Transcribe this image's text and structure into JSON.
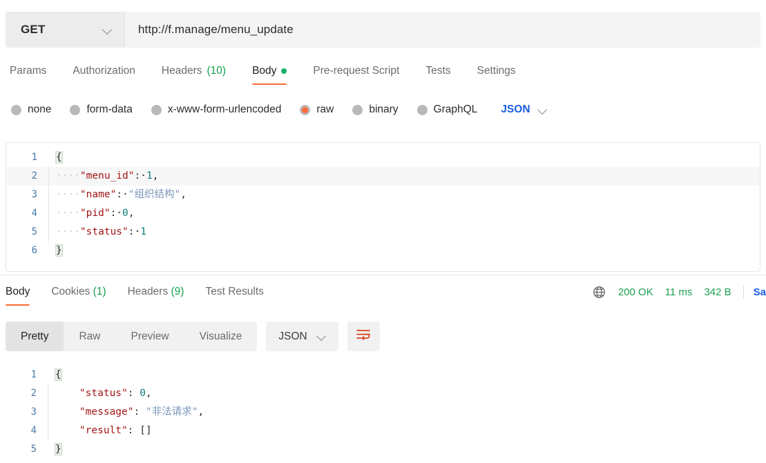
{
  "request": {
    "method": "GET",
    "method_icon": "chevron-down-icon",
    "url": "http://f.manage/menu_update",
    "tabs": [
      {
        "label": "Params",
        "active": false
      },
      {
        "label": "Authorization",
        "active": false
      },
      {
        "label": "Headers",
        "count": "(10)",
        "active": false
      },
      {
        "label": "Body",
        "active": true,
        "dot": true
      },
      {
        "label": "Pre-request Script",
        "active": false
      },
      {
        "label": "Tests",
        "active": false
      },
      {
        "label": "Settings",
        "active": false
      }
    ],
    "body_types": [
      {
        "label": "none",
        "selected": false
      },
      {
        "label": "form-data",
        "selected": false
      },
      {
        "label": "x-www-form-urlencoded",
        "selected": false
      },
      {
        "label": "raw",
        "selected": true
      },
      {
        "label": "binary",
        "selected": false
      },
      {
        "label": "GraphQL",
        "selected": false
      }
    ],
    "body_format": "JSON",
    "body_format_icon": "chevron-down-icon",
    "code_lines": [
      {
        "n": "1",
        "parts": [
          {
            "t": "{",
            "c": "brk"
          }
        ]
      },
      {
        "n": "2",
        "parts": [
          {
            "t": "····",
            "c": "dots"
          },
          {
            "t": "\"menu_id\"",
            "c": "k"
          },
          {
            "t": ":·",
            "c": "p"
          },
          {
            "t": "1",
            "c": "num"
          },
          {
            "t": ",",
            "c": "p"
          }
        ]
      },
      {
        "n": "3",
        "parts": [
          {
            "t": "····",
            "c": "dots"
          },
          {
            "t": "\"name\"",
            "c": "k"
          },
          {
            "t": ":·",
            "c": "p"
          },
          {
            "t": "\"组织结构\"",
            "c": "str"
          },
          {
            "t": ",",
            "c": "p"
          }
        ]
      },
      {
        "n": "4",
        "parts": [
          {
            "t": "····",
            "c": "dots"
          },
          {
            "t": "\"pid\"",
            "c": "k"
          },
          {
            "t": ":·",
            "c": "p"
          },
          {
            "t": "0",
            "c": "num"
          },
          {
            "t": ",",
            "c": "p"
          }
        ]
      },
      {
        "n": "5",
        "parts": [
          {
            "t": "····",
            "c": "dots"
          },
          {
            "t": "\"status\"",
            "c": "k"
          },
          {
            "t": ":·",
            "c": "p"
          },
          {
            "t": "1",
            "c": "num"
          }
        ]
      },
      {
        "n": "6",
        "parts": [
          {
            "t": "}",
            "c": "brk"
          }
        ]
      }
    ]
  },
  "response": {
    "tabs": [
      {
        "label": "Body",
        "active": true
      },
      {
        "label": "Cookies",
        "count": "(1)",
        "active": false
      },
      {
        "label": "Headers",
        "count": "(9)",
        "active": false
      },
      {
        "label": "Test Results",
        "active": false
      }
    ],
    "globe_icon": "globe-icon",
    "status": "200 OK",
    "time": "11 ms",
    "size": "342 B",
    "save_label": "Sa",
    "view_modes": [
      {
        "label": "Pretty",
        "active": true
      },
      {
        "label": "Raw",
        "active": false
      },
      {
        "label": "Preview",
        "active": false
      },
      {
        "label": "Visualize",
        "active": false
      }
    ],
    "format": "JSON",
    "format_icon": "chevron-down-icon",
    "wrap_icon": "word-wrap-icon",
    "code_lines": [
      {
        "n": "1",
        "parts": [
          {
            "t": "{",
            "c": "brk"
          }
        ]
      },
      {
        "n": "2",
        "parts": [
          {
            "t": "    ",
            "c": "p"
          },
          {
            "t": "\"status\"",
            "c": "k"
          },
          {
            "t": ": ",
            "c": "p"
          },
          {
            "t": "0",
            "c": "num"
          },
          {
            "t": ",",
            "c": "p"
          }
        ]
      },
      {
        "n": "3",
        "parts": [
          {
            "t": "    ",
            "c": "p"
          },
          {
            "t": "\"message\"",
            "c": "k"
          },
          {
            "t": ": ",
            "c": "p"
          },
          {
            "t": "\"非法请求\"",
            "c": "str"
          },
          {
            "t": ",",
            "c": "p"
          }
        ]
      },
      {
        "n": "4",
        "parts": [
          {
            "t": "    ",
            "c": "p"
          },
          {
            "t": "\"result\"",
            "c": "k"
          },
          {
            "t": ": ",
            "c": "p"
          },
          {
            "t": "[]",
            "c": "p"
          }
        ]
      },
      {
        "n": "5",
        "parts": [
          {
            "t": "}",
            "c": "brk"
          }
        ]
      }
    ]
  },
  "colors": {
    "accent_orange": "#ff6c37",
    "link_blue": "#1a5ce0",
    "status_green": "#1d9f54",
    "key_red": "#a31515",
    "number_teal": "#0e7c7b",
    "string_blue": "#7b96b8",
    "gutter_blue": "#4a7ba7"
  }
}
